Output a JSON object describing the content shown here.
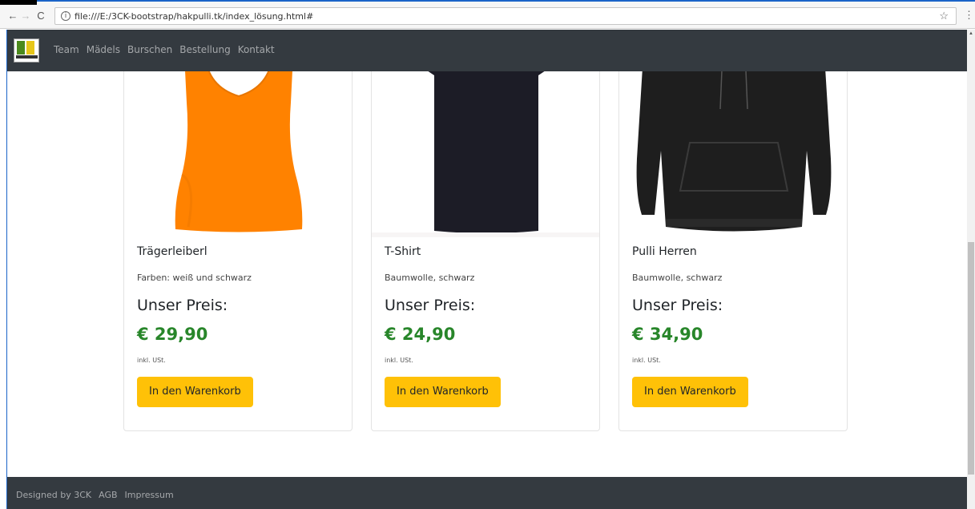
{
  "browser": {
    "url": "file:///E:/3CK-bootstrap/hakpulli.tk/index_lösung.html#",
    "nav_back": "←",
    "nav_forward": "→",
    "nav_reload": "C",
    "info": "i",
    "star": "☆",
    "menu": "⋮"
  },
  "navbar": {
    "links": [
      "Team",
      "Mädels",
      "Burschen",
      "Bestellung",
      "Kontakt"
    ]
  },
  "products": [
    {
      "title": "Trägerleiberl",
      "description": "Farben: weiß und schwarz",
      "price_label": "Unser Preis:",
      "price": "€ 29,90",
      "tax_note": "inkl. USt.",
      "button": "In den Warenkorb",
      "image_color": "#ff8200"
    },
    {
      "title": "T-Shirt",
      "description": "Baumwolle, schwarz",
      "price_label": "Unser Preis:",
      "price": "€ 24,90",
      "tax_note": "inkl. USt.",
      "button": "In den Warenkorb",
      "image_color": "#1c1c26"
    },
    {
      "title": "Pulli Herren",
      "description": "Baumwolle, schwarz",
      "price_label": "Unser Preis:",
      "price": "€ 34,90",
      "tax_note": "inkl. USt.",
      "button": "In den Warenkorb",
      "image_color": "#1e1e1e"
    }
  ],
  "footer": {
    "links": [
      "Designed by 3CK",
      "AGB",
      "Impressum"
    ]
  },
  "colors": {
    "navbar": "#343a40",
    "price_green": "#28862a",
    "button_yellow": "#ffc107"
  }
}
